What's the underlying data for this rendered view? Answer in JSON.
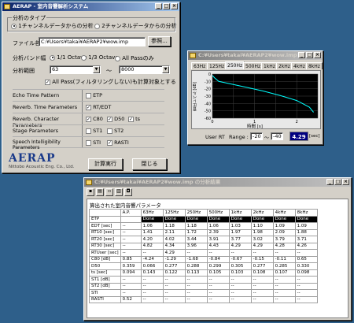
{
  "main_window": {
    "title": "AERAP - 室内音響解析システム",
    "analysis_type_label": "分析のタイプ",
    "analysis_type_options": [
      "1チャンネルデータからの分析",
      "2チャンネルデータからの分析"
    ],
    "analysis_type_selected": 0,
    "file_name_label": "ファイル名",
    "file_name_value": "C:¥Users¥takai¥AERAP2¥wow.imp",
    "browse_label": "参照...",
    "band_label": "分析バンド幅",
    "band_options": [
      "1/1 Octave",
      "1/3 Octave",
      "All Passのみ"
    ],
    "band_selected": 0,
    "range_label": "分析範囲",
    "range_from": "63",
    "range_to": "8000",
    "range_sep": "～",
    "allpass_label": "All Pass(フィルタリングしない)も計算対象とする",
    "allpass_checked": true,
    "params": [
      {
        "label": "Echo Time Pattern",
        "options": [
          {
            "text": "ETP",
            "checked": false
          }
        ]
      },
      {
        "label": "Reverb. Time Parameters",
        "options": [
          {
            "text": "RT/EDT",
            "checked": true
          }
        ]
      },
      {
        "label": "Reverb. Character Parameters",
        "options": [
          {
            "text": "C80",
            "checked": true
          },
          {
            "text": "D50",
            "checked": true
          },
          {
            "text": "ts",
            "checked": true
          }
        ]
      },
      {
        "label": "Stage Parameters",
        "options": [
          {
            "text": "ST1",
            "checked": false
          },
          {
            "text": "ST2",
            "checked": false
          }
        ]
      },
      {
        "label": "Speech Intelligibility Parameters",
        "options": [
          {
            "text": "STI",
            "checked": false
          },
          {
            "text": "RASTI",
            "checked": true
          }
        ]
      }
    ],
    "logo_text": "AERAP",
    "company": "Nittobo Acoustic Eng. Co., Ltd.",
    "run_button": "計算実行",
    "close_button": "閉じる"
  },
  "graph_window": {
    "title": "C:¥Users¥takai¥AERAP2¥wow.imp の 残響減衰",
    "tabs": [
      "63Hz",
      "125Hz",
      "250Hz",
      "500Hz",
      "1kHz",
      "2kHz",
      "4kHz",
      "8kHz"
    ],
    "active_tab": 2,
    "y_label": "音圧レベル [dB]",
    "x_label": "時間 [s]",
    "y_ticks": [
      "0",
      "-10",
      "-20",
      "-30",
      "-40",
      "-50",
      "-60"
    ],
    "x_ticks": [
      "0",
      "1",
      "2"
    ],
    "user_rt_label": "User RT",
    "range_label": "Range :",
    "range_from": "-20",
    "range_sep": "～",
    "range_to": "-40",
    "rt_value": "4.29",
    "rt_unit": "[sec]",
    "decay_curve": [
      [
        0,
        -2
      ],
      [
        0.05,
        -5
      ],
      [
        0.15,
        -10
      ],
      [
        0.4,
        -13
      ],
      [
        0.8,
        -18
      ],
      [
        1.2,
        -23
      ],
      [
        1.6,
        -29
      ],
      [
        2.0,
        -36
      ],
      [
        2.3,
        -45
      ],
      [
        2.4,
        -52
      ]
    ]
  },
  "results_window": {
    "title": "C:¥Users¥takai¥AERAP2¥wow.imp の分析結果",
    "subtitle": "算出された室内音響パラメータ",
    "columns": [
      "",
      "A.P.",
      "63Hz",
      "125Hz",
      "250Hz",
      "500Hz",
      "1kHz",
      "2kHz",
      "4kHz",
      "8kHz"
    ],
    "rows": [
      [
        "ETP",
        "",
        "Done",
        "Done",
        "Done",
        "Done",
        "Done",
        "Done",
        "Done",
        "Done"
      ],
      [
        "EDT [sec]",
        "--",
        "1.06",
        "1.18",
        "1.18",
        "1.06",
        "1.03",
        "1.10",
        "1.09",
        "1.09"
      ],
      [
        "RT10 [sec]",
        "--",
        "1.41",
        "2.11",
        "1.72",
        "2.39",
        "1.97",
        "1.98",
        "2.09",
        "1.88"
      ],
      [
        "RT20 [sec]",
        "--",
        "4.20",
        "4.02",
        "3.44",
        "3.91",
        "3.77",
        "3.02",
        "3.79",
        "3.71"
      ],
      [
        "RT30 [sec]",
        "--",
        "4.82",
        "4.34",
        "3.96",
        "4.43",
        "4.29",
        "4.29",
        "4.28",
        "4.26"
      ],
      [
        "RTUser [sec]",
        "--",
        "--",
        "4.29",
        "--",
        "--",
        "--",
        "--",
        "--",
        "--"
      ],
      [
        "C80 [dB]",
        "0.85",
        "-4.24",
        "-1.29",
        "-1.68",
        "-0.84",
        "-0.67",
        "-0.15",
        "-0.11",
        "0.65"
      ],
      [
        "D50",
        "0.359",
        "0.066",
        "0.277",
        "0.288",
        "0.299",
        "0.305",
        "0.277",
        "0.285",
        "0.330"
      ],
      [
        "ts [sec]",
        "0.094",
        "0.143",
        "0.122",
        "0.113",
        "0.105",
        "0.103",
        "0.108",
        "0.107",
        "0.098"
      ],
      [
        "ST1 [dB]",
        "--",
        "--",
        "--",
        "--",
        "--",
        "--",
        "--",
        "--",
        "--"
      ],
      [
        "ST2 [dB]",
        "--",
        "--",
        "--",
        "--",
        "--",
        "--",
        "--",
        "--",
        "--"
      ],
      [
        "STI",
        "--",
        "--",
        "--",
        "--",
        "--",
        "--",
        "--",
        "--",
        "--"
      ],
      [
        "RASTI",
        "0.52",
        "--",
        "--",
        "--",
        "--",
        "--",
        "--",
        "--",
        "--"
      ]
    ]
  },
  "colors": {
    "desktop": "#2e5f8a",
    "graph_bg": "#000000",
    "graph_grid": "#404040",
    "decay_curve": "#00ffff",
    "rt_value_bg": "#000080",
    "rt_value_fg": "#ffffff"
  }
}
